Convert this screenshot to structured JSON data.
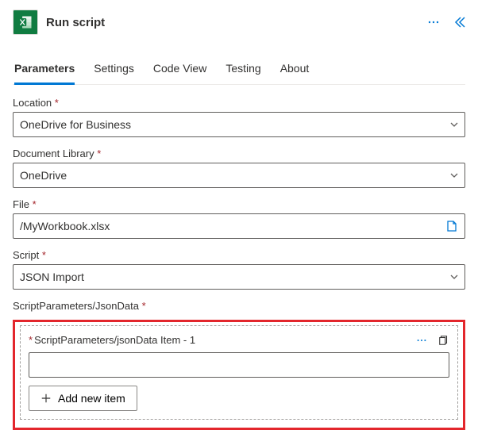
{
  "header": {
    "title": "Run script"
  },
  "tabs": [
    {
      "label": "Parameters",
      "active": true
    },
    {
      "label": "Settings"
    },
    {
      "label": "Code View"
    },
    {
      "label": "Testing"
    },
    {
      "label": "About"
    }
  ],
  "form": {
    "location": {
      "label": "Location",
      "required": "*",
      "value": "OneDrive for Business"
    },
    "library": {
      "label": "Document Library",
      "required": "*",
      "value": "OneDrive"
    },
    "file": {
      "label": "File",
      "required": "*",
      "value": "/MyWorkbook.xlsx"
    },
    "script": {
      "label": "Script",
      "required": "*",
      "value": "JSON Import"
    }
  },
  "jsonData": {
    "section_label": "ScriptParameters/JsonData",
    "section_required": "*",
    "item_label": "ScriptParameters/jsonData Item - 1",
    "item_required": "*",
    "item_value": "",
    "add_label": "Add new item"
  }
}
